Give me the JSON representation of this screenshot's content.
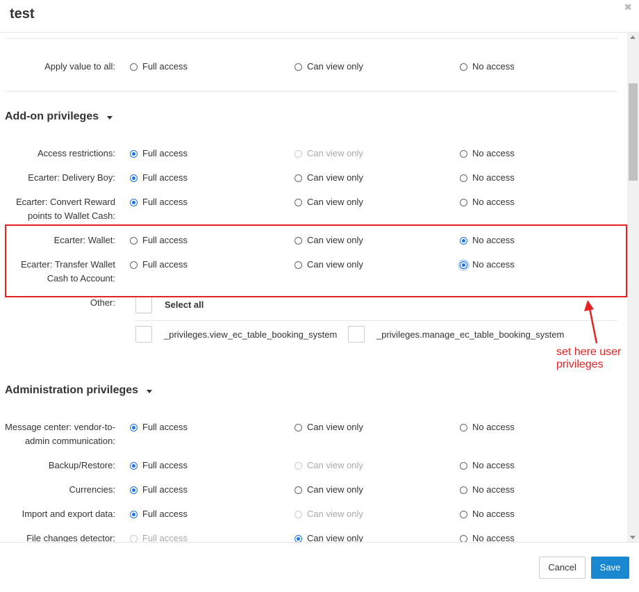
{
  "dialog": {
    "title": "test"
  },
  "options": {
    "full": "Full access",
    "view": "Can view only",
    "none": "No access"
  },
  "apply_all": {
    "label": "Apply value to all:"
  },
  "addon": {
    "title": "Add-on privileges",
    "rows": [
      {
        "label": "Access restrictions:",
        "selected": "full",
        "view_disabled": true
      },
      {
        "label": "Ecarter: Delivery Boy:",
        "selected": "full"
      },
      {
        "label1": "Ecarter: Convert Reward",
        "label2": "points to Wallet Cash:",
        "selected": "full"
      },
      {
        "label": "Ecarter: Wallet:",
        "selected": "none"
      },
      {
        "label1": "Ecarter: Transfer Wallet",
        "label2": "Cash to Account:",
        "selected": "none"
      }
    ],
    "other": {
      "label": "Other:",
      "select_all": "Select all",
      "items": [
        "_privileges.view_ec_table_booking_system",
        "_privileges.manage_ec_table_booking_system"
      ]
    }
  },
  "admin": {
    "title": "Administration privileges",
    "rows": [
      {
        "label1": "Message center: vendor-to-",
        "label2": "admin communication:",
        "selected": "full"
      },
      {
        "label": "Backup/Restore:",
        "selected": "full",
        "view_disabled": true
      },
      {
        "label": "Currencies:",
        "selected": "full"
      },
      {
        "label": "Import and export data:",
        "selected": "full",
        "view_disabled": true
      },
      {
        "label": "File changes detector:",
        "selected": "view",
        "full_disabled": true
      }
    ]
  },
  "annotation": {
    "line1": "set here user",
    "line2": "privileges"
  },
  "footer": {
    "cancel": "Cancel",
    "save": "Save"
  },
  "colors": {
    "accent": "#1a73e8",
    "annotation": "#e52222",
    "save_button": "#1a87d1"
  }
}
